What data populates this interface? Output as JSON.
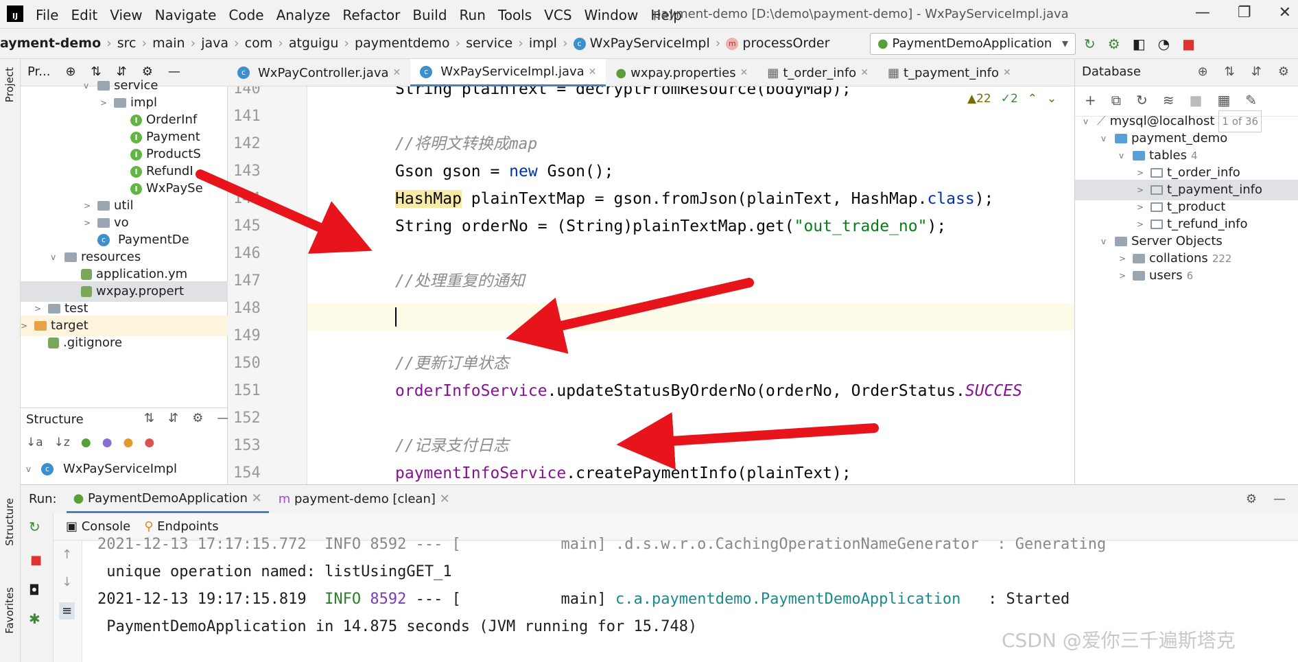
{
  "menubar": {
    "logo": "IJ",
    "items": [
      "File",
      "Edit",
      "View",
      "Navigate",
      "Code",
      "Analyze",
      "Refactor",
      "Build",
      "Run",
      "Tools",
      "VCS",
      "Window",
      "Help"
    ],
    "title": "payment-demo [D:\\demo\\payment-demo] - WxPayServiceImpl.java"
  },
  "breadcrumb": {
    "items": [
      "ayment-demo",
      "src",
      "main",
      "java",
      "com",
      "atguigu",
      "paymentdemo",
      "service",
      "impl",
      "WxPayServiceImpl",
      "processOrder"
    ]
  },
  "run_config": "PaymentDemoApplication",
  "project_panel": {
    "title": "Pr...",
    "tree": [
      {
        "label": "service",
        "depth": 5,
        "chev": "v"
      },
      {
        "label": "impl",
        "depth": 6,
        "chev": ">"
      },
      {
        "label": "OrderInf",
        "depth": 7
      },
      {
        "label": "Payment",
        "depth": 7
      },
      {
        "label": "ProductS",
        "depth": 7
      },
      {
        "label": "RefundI",
        "depth": 7
      },
      {
        "label": "WxPaySe",
        "depth": 7
      },
      {
        "label": "util",
        "depth": 5,
        "chev": ">"
      },
      {
        "label": "vo",
        "depth": 5,
        "chev": ">"
      },
      {
        "label": "PaymentDe",
        "depth": 5
      },
      {
        "label": "resources",
        "depth": 3,
        "chev": "v"
      },
      {
        "label": "application.ym",
        "depth": 4
      },
      {
        "label": "wxpay.propert",
        "depth": 4
      },
      {
        "label": "test",
        "depth": 2,
        "chev": ">"
      },
      {
        "label": "target",
        "depth": 1,
        "chev": ">"
      },
      {
        "label": ".gitignore",
        "depth": 2
      }
    ]
  },
  "structure": {
    "title": "Structure",
    "root": "WxPayServiceImpl"
  },
  "tabs": [
    {
      "label": "WxPayController.java"
    },
    {
      "label": "WxPayServiceImpl.java",
      "active": true
    },
    {
      "label": "wxpay.properties"
    },
    {
      "label": "t_order_info"
    },
    {
      "label": "t_payment_info"
    }
  ],
  "editor": {
    "warnings": "22",
    "oks": "2",
    "lines": [
      {
        "n": "140",
        "code": "String plainText = decryptFromResource(bodyMap);"
      },
      {
        "n": "141",
        "code": ""
      },
      {
        "n": "142",
        "comment": "//将明文转换成map"
      },
      {
        "n": "143",
        "code": "Gson gson = new Gson();"
      },
      {
        "n": "144",
        "code": "HashMap plainTextMap = gson.fromJson(plainText, HashMap.class);"
      },
      {
        "n": "145",
        "code": "String orderNo = (String)plainTextMap.get(\"out_trade_no\");"
      },
      {
        "n": "146",
        "code": ""
      },
      {
        "n": "147",
        "comment": "//处理重复的通知"
      },
      {
        "n": "148",
        "code": ""
      },
      {
        "n": "149",
        "code": ""
      },
      {
        "n": "150",
        "comment": "//更新订单状态"
      },
      {
        "n": "151",
        "code": "orderInfoService.updateStatusByOrderNo(orderNo, OrderStatus.SUCCES"
      },
      {
        "n": "152",
        "code": ""
      },
      {
        "n": "153",
        "comment": "//记录支付日志"
      },
      {
        "n": "154",
        "code": "paymentInfoService.createPaymentInfo(plainText);"
      }
    ]
  },
  "database": {
    "title": "Database",
    "tree": [
      {
        "label": "mysql@localhost",
        "count": "1 of 36",
        "depth": 0,
        "chev": "v"
      },
      {
        "label": "payment_demo",
        "depth": 1,
        "chev": "v"
      },
      {
        "label": "tables",
        "count": "4",
        "depth": 2,
        "chev": "v"
      },
      {
        "label": "t_order_info",
        "depth": 3,
        "chev": ">"
      },
      {
        "label": "t_payment_info",
        "depth": 3,
        "chev": ">",
        "selected": true
      },
      {
        "label": "t_product",
        "depth": 3,
        "chev": ">"
      },
      {
        "label": "t_refund_info",
        "depth": 3,
        "chev": ">"
      },
      {
        "label": "Server Objects",
        "depth": 1,
        "chev": "v"
      },
      {
        "label": "collations",
        "count": "222",
        "depth": 2,
        "chev": ">"
      },
      {
        "label": "users",
        "count": "6",
        "depth": 2,
        "chev": ">"
      }
    ]
  },
  "run": {
    "label": "Run:",
    "tabs": [
      "PaymentDemoApplication",
      "payment-demo [clean]"
    ],
    "subtabs": [
      "Console",
      "Endpoints"
    ]
  },
  "console": {
    "line0": "2021-12-13 17:17:15.772  INFO 8592 --- [           main] .d.s.w.r.o.CachingOperationNameGenerator  : Generating",
    "line1": " unique operation named: listUsingGET_1",
    "line2_ts": "2021-12-13 19:17:15.819",
    "line2_info": "INFO",
    "line2_pid": "8592",
    "line2_mid": " --- [           main] ",
    "line2_cls": "c.a.paymentdemo.PaymentDemoApplication",
    "line2_end": "   : Started",
    "line3": " PaymentDemoApplication in 14.875 seconds (JVM running for 15.748)"
  },
  "side_labels": {
    "project": "Project",
    "structure": "Structure",
    "favorites": "Favorites"
  },
  "watermark": "CSDN @爱你三千遍斯塔克",
  "colors": {
    "arrow": "#e8141b",
    "accent": "#4083c9"
  }
}
